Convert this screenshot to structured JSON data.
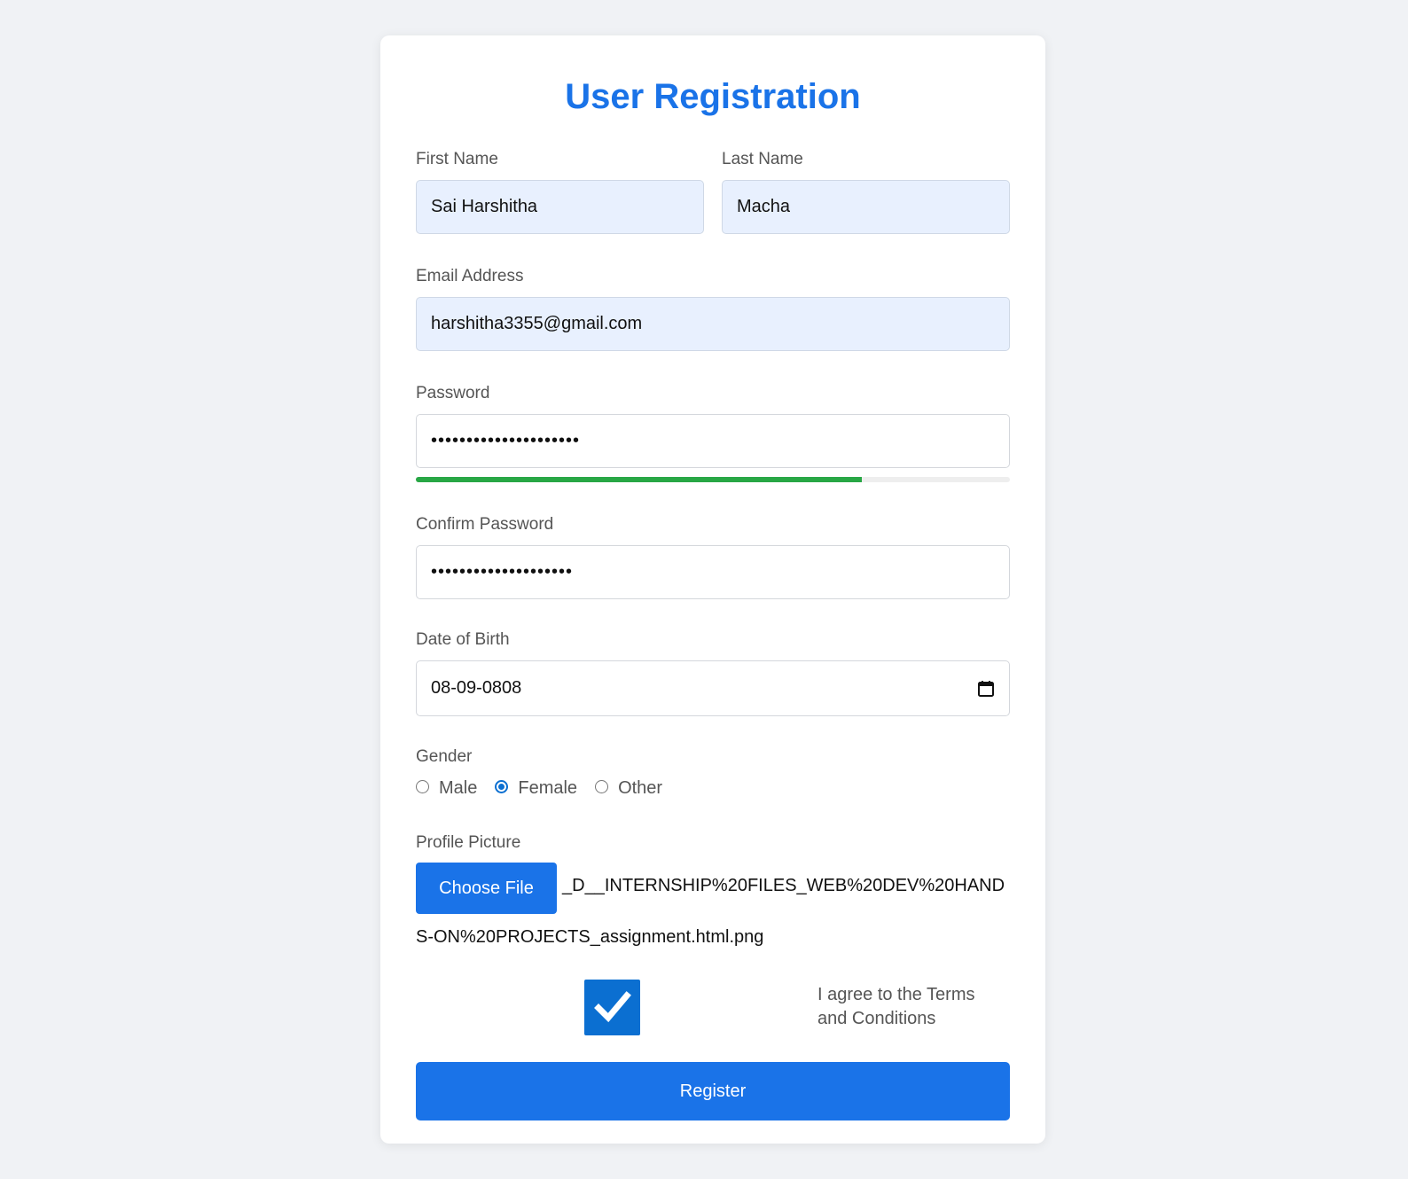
{
  "form": {
    "title": "User Registration",
    "first_name": {
      "label": "First Name",
      "value": "Sai Harshitha"
    },
    "last_name": {
      "label": "Last Name",
      "value": "Macha"
    },
    "email": {
      "label": "Email Address",
      "value": "harshitha3355@gmail.com"
    },
    "password": {
      "label": "Password",
      "masked_value": "•••••••••••••••••••••",
      "strength_percent": 75,
      "strength_color": "#28a745"
    },
    "confirm_password": {
      "label": "Confirm Password",
      "masked_value": "••••••••••••••••••••"
    },
    "dob": {
      "label": "Date of Birth",
      "value": "08-09-0808",
      "icon": "calendar-icon"
    },
    "gender": {
      "label": "Gender",
      "options": [
        "Male",
        "Female",
        "Other"
      ],
      "selected": "Female"
    },
    "profile_picture": {
      "label": "Profile Picture",
      "button_label": "Choose File",
      "file_name": "_D__INTERNSHIP%20FILES_WEB%20DEV%20HANDS-ON%20PROJECTS_assignment.html.png"
    },
    "terms": {
      "label": "I agree to the Terms and Conditions",
      "checked": true
    },
    "submit_label": "Register"
  },
  "colors": {
    "accent": "#1a73e8",
    "background": "#f0f2f5",
    "autofill": "#e8f0fe"
  }
}
